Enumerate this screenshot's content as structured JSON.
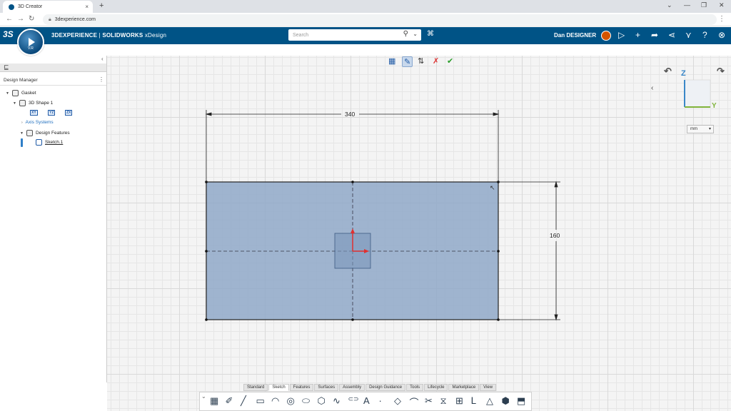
{
  "browser": {
    "tab_title": "3D Creator",
    "tab_close": "×",
    "new_tab": "+",
    "url": "3dexperience.com",
    "nav_back": "←",
    "nav_forward": "→",
    "nav_reload": "↻",
    "menu": "⋮",
    "window_controls": [
      "⌄",
      "—",
      "❐",
      "✕"
    ]
  },
  "app_header": {
    "logo": "3S",
    "brand_prefix": "3DEXPERIENCE",
    "brand_separator": " | ",
    "brand_app": "SOLIDWORKS",
    "brand_suffix": " xDesign",
    "search_placeholder": "Search",
    "search_icon": "⚲",
    "search_caret": "⌄",
    "tag_icon": "⌘",
    "user_name": "Dan DESIGNER",
    "compass_version": "V.R",
    "header_icons": [
      "chat-icon",
      "add-icon",
      "share-icon",
      "network-icon",
      "apps-icon",
      "help-icon",
      "bookmark-icon"
    ],
    "header_icon_glyphs": [
      "▷",
      "+",
      "➦",
      "⋖",
      "⋎",
      "?",
      "⊗"
    ],
    "accent_color": "#005386"
  },
  "design_manager": {
    "title": "Design Manager",
    "collapse": "‹",
    "more": "⋮",
    "tree_tab_icon": "⊑",
    "tree": {
      "root": "Gasket",
      "shape": "3D Shape 1",
      "planes": [
        "XY",
        "YZ",
        "ZX"
      ],
      "axis_systems": "Axis Systems",
      "design_features": "Design Features",
      "sketch": "Sketch.1"
    }
  },
  "viewport": {
    "toolbar_icons": [
      "grid-icon",
      "sketch-mode-icon",
      "snap-icon",
      "cancel-sketch-icon",
      "accept-sketch-icon"
    ],
    "toolbar_glyphs": [
      "▦",
      "✎",
      "⇅",
      "✗",
      "✔"
    ],
    "dimension_width": "340",
    "dimension_height": "160",
    "triad_z": "Z",
    "triad_y": "Y",
    "triad_back": "‹",
    "rotate_left": "↶",
    "rotate_right": "↷",
    "unit": "mm",
    "unit_caret": "▾",
    "sketch_fill_color": "#8fa8c8",
    "origin_color": "#e03030"
  },
  "action_bar": {
    "tabs": [
      "Standard",
      "Sketch",
      "Features",
      "Surfaces",
      "Assembly",
      "Design Guidance",
      "Tools",
      "Lifecycle",
      "Marketplace",
      "View"
    ],
    "active_tab": "Sketch",
    "tool_names": [
      "grid-tool-icon",
      "pen-tool-icon",
      "line-tool-icon",
      "rectangle-tool-icon",
      "arc-tool-icon",
      "circle-tool-icon",
      "ellipse-tool-icon",
      "polygon-tool-icon",
      "spline-tool-icon",
      "slot-tool-icon",
      "text-tool-icon",
      "point-tool-icon",
      "offset-tool-icon",
      "fillet-tool-icon",
      "trim-tool-icon",
      "mirror-tool-icon",
      "pattern-tool-icon",
      "convert-tool-icon",
      "constraint-tool-icon",
      "dimension-tool-icon",
      "project-tool-icon"
    ],
    "tool_glyphs": [
      "▦",
      "✐",
      "╱",
      "▭",
      "◠",
      "◎",
      "⬭",
      "⬡",
      "∿",
      "⊂⊃",
      "A",
      "·",
      "◇",
      "⌒",
      "✂",
      "⧖",
      "⊞",
      "ᒪ",
      "△",
      "⬢",
      "⬒"
    ]
  }
}
